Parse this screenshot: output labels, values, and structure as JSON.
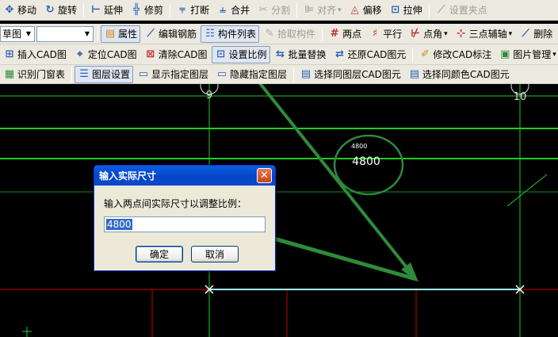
{
  "toolbar1": {
    "move": "移动",
    "rotate": "旋转",
    "extend": "延伸",
    "trim": "修剪",
    "break": "打断",
    "merge": "合并",
    "split": "分割",
    "align": "对齐",
    "offset": "偏移",
    "stretch": "拉伸",
    "set_grip": "设置夹点"
  },
  "toolbar2": {
    "layer_combo": "草图",
    "filter_combo": "",
    "properties": "属性",
    "edit_rebar": "编辑钢筋",
    "component_list": "构件列表",
    "pick_component": "拾取构件",
    "two_points": "两点",
    "parallel": "平行",
    "point_angle": "点角",
    "three_point_aux": "三点辅轴",
    "delete": "删除"
  },
  "toolbar3": {
    "insert_cad": "插入CAD图",
    "locate_cad": "定位CAD图",
    "clear_cad": "清除CAD图",
    "set_scale": "设置比例",
    "batch_replace": "批量替换",
    "restore_cad": "还原CAD图元",
    "modify_cad_label": "修改CAD标注",
    "image_manage": "图片管理"
  },
  "toolbar4": {
    "identify_doors": "识别门窗表",
    "layer_settings": "图层设置",
    "show_layer": "显示指定图层",
    "hide_layer": "隐藏指定图层",
    "select_same_layer": "选择同图层CAD图元",
    "select_same_color": "选择同颜色CAD图元"
  },
  "drawing": {
    "axis_left": "9",
    "axis_right": "10",
    "dim_small": "4800",
    "dim_large": "4800"
  },
  "dialog": {
    "title": "输入实际尺寸",
    "prompt": "输入两点间实际尺寸以调整比例：",
    "value": "4800",
    "ok": "确定",
    "cancel": "取消"
  },
  "colors": {
    "canvas_bg": "#000000",
    "axis_line": "#22cc22",
    "wall_red": "#cc0000",
    "measure_line": "#9fffff",
    "arrow": "#2e8b3a",
    "annotation_circle": "#2e8b3a"
  }
}
